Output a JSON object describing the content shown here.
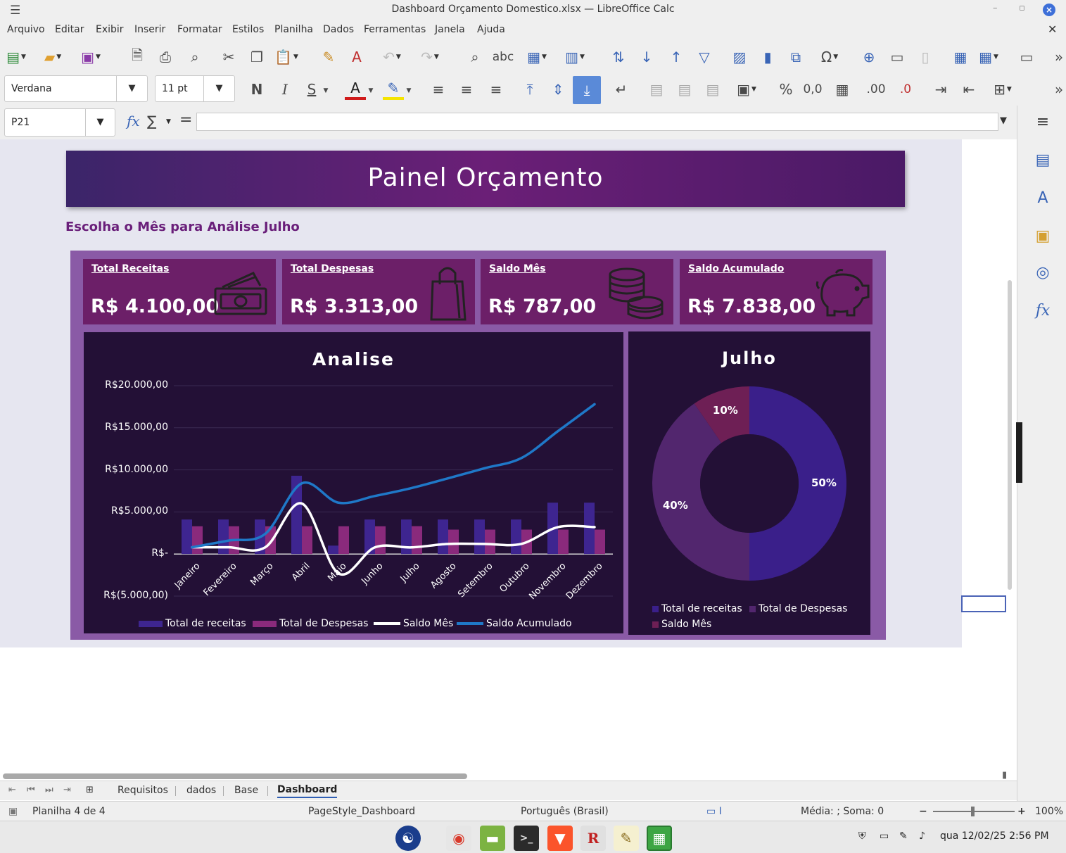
{
  "window": {
    "title": "Dashboard Orçamento Domestico.xlsx — LibreOffice Calc",
    "min": "–",
    "max": "▫",
    "close": "×"
  },
  "menu": [
    "Arquivo",
    "Editar",
    "Exibir",
    "Inserir",
    "Formatar",
    "Estilos",
    "Planilha",
    "Dados",
    "Ferramentas",
    "Janela",
    "Ajuda"
  ],
  "toolbar": {
    "font_name": "Verdana",
    "font_size": "11 pt",
    "bold": "N",
    "italic": "I",
    "underline": "S",
    "font_color_letter": "A",
    "percent": "%",
    "number": "0,0",
    "add_decimal": ".00",
    "remove_decimal": ".0"
  },
  "formula": {
    "cell_ref": "P21",
    "fx": "fx",
    "sum": "∑",
    "equals": "=",
    "content": ""
  },
  "dashboard": {
    "title": "Painel Orçamento",
    "month_prompt": "Escolha o Mês para Análise Julho",
    "cards": [
      {
        "label": "Total Receitas",
        "value": "R$ 4.100,00",
        "icon": "money-icon"
      },
      {
        "label": "Total Despesas",
        "value": "R$ 3.313,00",
        "icon": "shopping-bag-icon"
      },
      {
        "label": "Saldo Mês",
        "value": "R$ 787,00",
        "icon": "coins-icon"
      },
      {
        "label": "Saldo Acumulado",
        "value": "R$ 7.838,00",
        "icon": "piggy-bank-icon"
      }
    ]
  },
  "chart_data": [
    {
      "type": "bar",
      "title": "Analise",
      "xlabel": "",
      "ylabel": "",
      "categories": [
        "Janeiro",
        "Fevereiro",
        "Março",
        "Abril",
        "Maio",
        "Junho",
        "Julho",
        "Agosto",
        "Setembro",
        "Outubro",
        "Novembro",
        "Dezembro"
      ],
      "ylim": [
        -5000,
        20000
      ],
      "yticks": [
        20000,
        15000,
        10000,
        5000,
        0,
        -5000
      ],
      "ytick_labels": [
        "R$20.000,00",
        "R$15.000,00",
        "R$10.000,00",
        "R$5.000,00",
        "R$-",
        "R$(5.000,00)"
      ],
      "grid": true,
      "legend": "bottom",
      "series": [
        {
          "name": "Total de receitas",
          "kind": "bar",
          "color": "#3e2590",
          "values": [
            4100,
            4100,
            4100,
            9300,
            1000,
            4100,
            4100,
            4100,
            4100,
            4100,
            6100,
            6100
          ]
        },
        {
          "name": "Total de Despesas",
          "kind": "bar",
          "color": "#8a2a7c",
          "values": [
            3300,
            3300,
            3300,
            3300,
            3300,
            3300,
            3313,
            2900,
            2900,
            2900,
            2900,
            2900
          ]
        },
        {
          "name": "Saldo Mês",
          "kind": "line",
          "color": "#ffffff",
          "values": [
            800,
            800,
            800,
            6000,
            -2300,
            800,
            787,
            1200,
            1200,
            1200,
            3200,
            3200
          ]
        },
        {
          "name": "Saldo Acumulado",
          "kind": "line",
          "color": "#1f78c8",
          "values": [
            800,
            1600,
            2400,
            8400,
            6100,
            6900,
            7838,
            9000,
            10200,
            11400,
            14600,
            17800
          ]
        }
      ]
    },
    {
      "type": "pie",
      "title": "Julho",
      "donut": true,
      "legend": "bottom",
      "categories": [
        "Total de receitas",
        "Total de Despesas",
        "Saldo Mês"
      ],
      "values": [
        4100,
        3313,
        787
      ],
      "percent_labels": [
        "50%",
        "40%",
        "10%"
      ],
      "colors": [
        "#3a1f8a",
        "#52266e",
        "#6e1f55"
      ]
    }
  ],
  "sheets": {
    "tabs": [
      "Requisitos",
      "dados",
      "Base",
      "Dashboard"
    ],
    "active": "Dashboard"
  },
  "status": {
    "sheet_info": "Planilha 4 de 4",
    "page_style": "PageStyle_Dashboard",
    "language": "Português (Brasil)",
    "summary": "Média: ; Soma: 0",
    "zoom": "100%"
  },
  "taskbar": {
    "datetime": "qua 12/02/25   2:56 PM",
    "apps": [
      "yin-yang-icon",
      "chrome-icon",
      "files-icon",
      "terminal-icon",
      "brave-icon",
      "r-icon",
      "editor-icon",
      "calc-icon"
    ]
  }
}
